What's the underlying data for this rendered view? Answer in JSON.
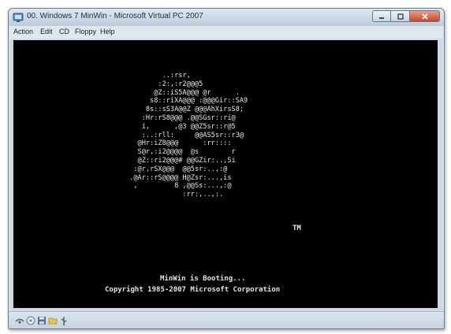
{
  "window": {
    "title": "00. Windows 7 MinWin - Microsoft Virtual PC 2007",
    "icon": "virtual-pc-icon"
  },
  "caption_buttons": [
    {
      "name": "minimize-button",
      "icon": "minimize-icon"
    },
    {
      "name": "maximize-button",
      "icon": "maximize-icon"
    },
    {
      "name": "close-button",
      "icon": "close-icon"
    }
  ],
  "menu": {
    "items": [
      "Action",
      "Edit",
      "CD",
      "Floppy",
      "Help"
    ]
  },
  "console": {
    "logo_lines": [
      "         ..:rsr,",
      "        :2:,:r2@@@5",
      "       @Z::iS5A@@@ @r      .",
      "      s8::riXA@@@ :@@@Gir::SA9",
      "     8s::sS3A@@Z @@@AhXirsS8;",
      "    :Hr:rS8@@@ .@@SGsr::ri@",
      "    i,      ,@3 @@Z5sr::r@5",
      "    :..:rll:     @@AS5sr::r3@",
      "   @Hr:iZ8@@@      :rr::::",
      "   S@r,:i2@@@@  @s        r",
      "   @Z::ri2@@@# @@GZir:..,Si",
      "  :@r,rSX@@@  @@5sr:..,:@",
      " .@Ar::rS@@@@ H@Zsr:...,is",
      "  ,         8 ,@@Ss:...,:@",
      "              :rr:,..,:."
    ],
    "trademark": "TM",
    "boot_status": "MinWin is Booting...",
    "copyright": "Copyright 1985-2007 Microsoft Corporation"
  },
  "statusbar": {
    "icons": [
      "network-icon",
      "cd-icon",
      "floppy-disk-icon",
      "folder-icon",
      "usb-icon"
    ]
  },
  "colors": {
    "screen_background": "#000000",
    "console_text": "#e6e6e6",
    "close_button": "#c7452a"
  }
}
